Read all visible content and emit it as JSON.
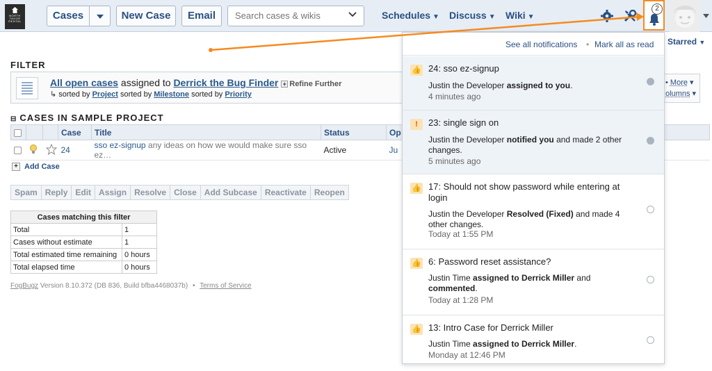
{
  "logo": {
    "line1": "NORTH",
    "line2": "TAHOE",
    "line3": "RENTAL"
  },
  "toolbar": {
    "cases_label": "Cases",
    "new_case_label": "New Case",
    "email_label": "Email",
    "search_placeholder": "Search cases & wikis",
    "menus": [
      {
        "label": "Schedules"
      },
      {
        "label": "Discuss"
      },
      {
        "label": "Wiki"
      }
    ],
    "notification_count": "2",
    "starred_label": "Starred"
  },
  "filter": {
    "heading": "FILTER",
    "text_link1": "All open cases",
    "text_mid": " assigned to ",
    "text_link2": "Derrick the Bug Finder",
    "refine_label": "Refine Further",
    "sorted_prefix": "sorted by ",
    "sort1": "Project",
    "sort2": "Milestone",
    "sort3": "Priority",
    "more_label": "More",
    "columns_label": "olumns"
  },
  "cases": {
    "heading": "CASES IN SAMPLE PROJECT",
    "columns": [
      "Case",
      "Title",
      "Status",
      "Op"
    ],
    "rows": [
      {
        "case": "24",
        "title": "sso ez-signup",
        "desc": "any ideas on how we would make sure sso ez…",
        "status": "Active",
        "op": "Ju"
      }
    ],
    "add_case_label": "Add Case"
  },
  "actions": [
    "Spam",
    "Reply",
    "Edit",
    "Assign",
    "Resolve",
    "Close",
    "Add Subcase",
    "Reactivate",
    "Reopen"
  ],
  "summary": {
    "header": "Cases matching this filter",
    "rows": [
      {
        "label": "Total",
        "value": "1"
      },
      {
        "label": "Cases without estimate",
        "value": "1"
      },
      {
        "label": "Total estimated time remaining",
        "value": "0 hours"
      },
      {
        "label": "Total elapsed time",
        "value": "0 hours"
      }
    ]
  },
  "footer": {
    "brand": "FogBugz",
    "version": " Version 8.10.372 (DB 836, Build bfba4468037b)",
    "sep": "•",
    "terms": "Terms of Service"
  },
  "notifications": {
    "see_all": "See all notifications",
    "sep": "•",
    "mark_all": "Mark all as read",
    "items": [
      {
        "title": "24: sso ez-signup",
        "body_pre": "Justin the Developer ",
        "body_bold": "assigned to you",
        "body_post": ".",
        "time": "4 minutes ago",
        "unread": true,
        "type_icon": "thumbs-up-icon"
      },
      {
        "title": "23: single sign on",
        "body_pre": "Justin the Developer ",
        "body_bold": "notified you",
        "body_post": " and made 2 other changes.",
        "time": "5 minutes ago",
        "unread": true,
        "type_icon": "exclamation-icon"
      },
      {
        "title": "17: Should not show password while entering at login",
        "body_pre": "Justin the Developer ",
        "body_bold": "Resolved (Fixed)",
        "body_post": " and made 4 other changes.",
        "time": "Today at 1:55 PM",
        "unread": false,
        "type_icon": "thumbs-up-icon"
      },
      {
        "title": "6: Password reset assistance?",
        "body_pre": "Justin Time ",
        "body_bold": "assigned to Derrick Miller",
        "body_mid": " and ",
        "body_bold2": "commented",
        "body_post": ".",
        "time": "Today at 1:28 PM",
        "unread": false,
        "type_icon": "thumbs-up-icon"
      },
      {
        "title": "13: Intro Case for Derrick Miller",
        "body_pre": "Justin Time ",
        "body_bold": "assigned to Derrick Miller",
        "body_post": ".",
        "time": "Monday at 12:46 PM",
        "unread": false,
        "type_icon": "thumbs-up-icon"
      }
    ]
  },
  "colors": {
    "accent": "#f58a1f",
    "link": "#2a5082",
    "unread_bg": "#eef3f8"
  }
}
